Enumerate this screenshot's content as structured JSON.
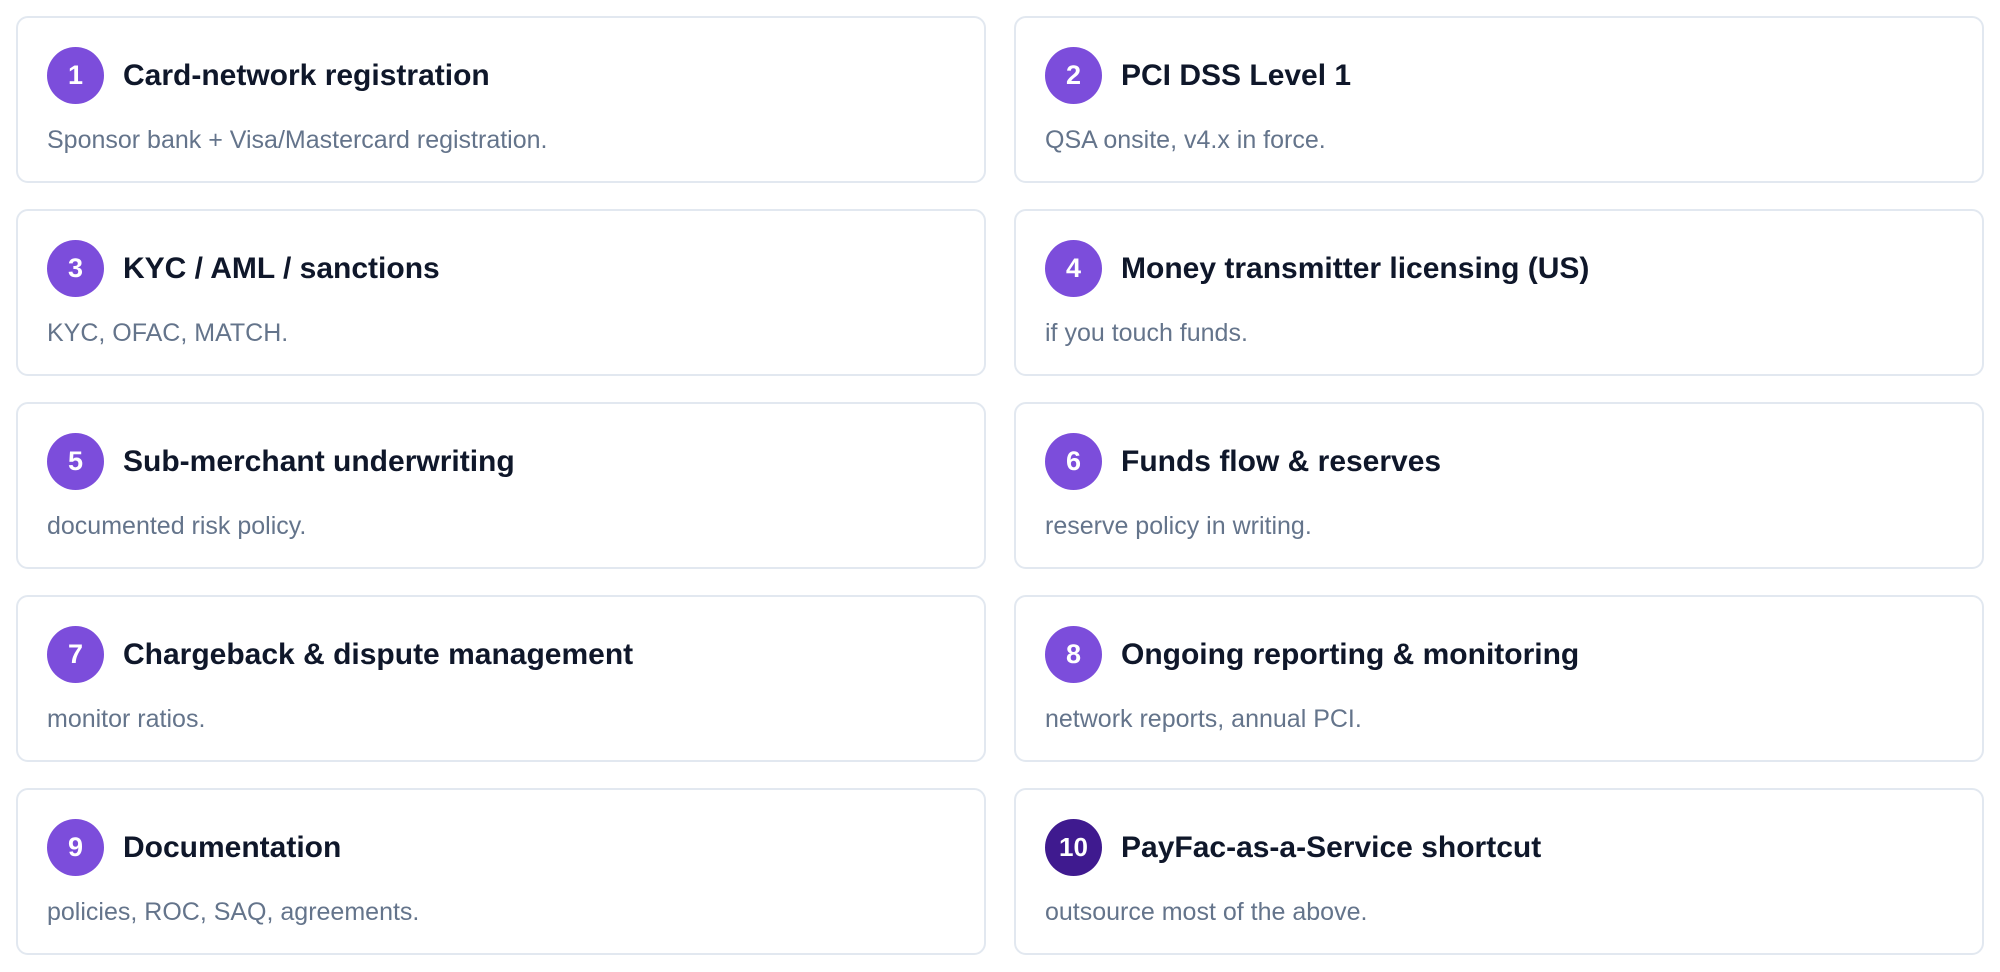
{
  "cards": [
    {
      "number": "1",
      "title": "Card-network registration",
      "description": "Sponsor bank + Visa/Mastercard registration."
    },
    {
      "number": "2",
      "title": "PCI DSS Level 1",
      "description": "QSA onsite, v4.x in force."
    },
    {
      "number": "3",
      "title": "KYC / AML / sanctions",
      "description": "KYC, OFAC, MATCH."
    },
    {
      "number": "4",
      "title": "Money transmitter licensing (US)",
      "description": "if you touch funds."
    },
    {
      "number": "5",
      "title": "Sub-merchant underwriting",
      "description": "documented risk policy."
    },
    {
      "number": "6",
      "title": "Funds flow & reserves",
      "description": "reserve policy in writing."
    },
    {
      "number": "7",
      "title": "Chargeback & dispute management",
      "description": "monitor ratios."
    },
    {
      "number": "8",
      "title": "Ongoing reporting & monitoring",
      "description": "network reports, annual PCI."
    },
    {
      "number": "9",
      "title": "Documentation",
      "description": "policies, ROC, SAQ, agreements."
    },
    {
      "number": "10",
      "title": "PayFac-as-a-Service shortcut",
      "description": "outsource most of the above."
    }
  ],
  "colors": {
    "badge": "#7c4ddb",
    "badge_highlight": "#3f1a8f",
    "title": "#0f172a",
    "description": "#64748b",
    "border": "#e2e8f0"
  }
}
